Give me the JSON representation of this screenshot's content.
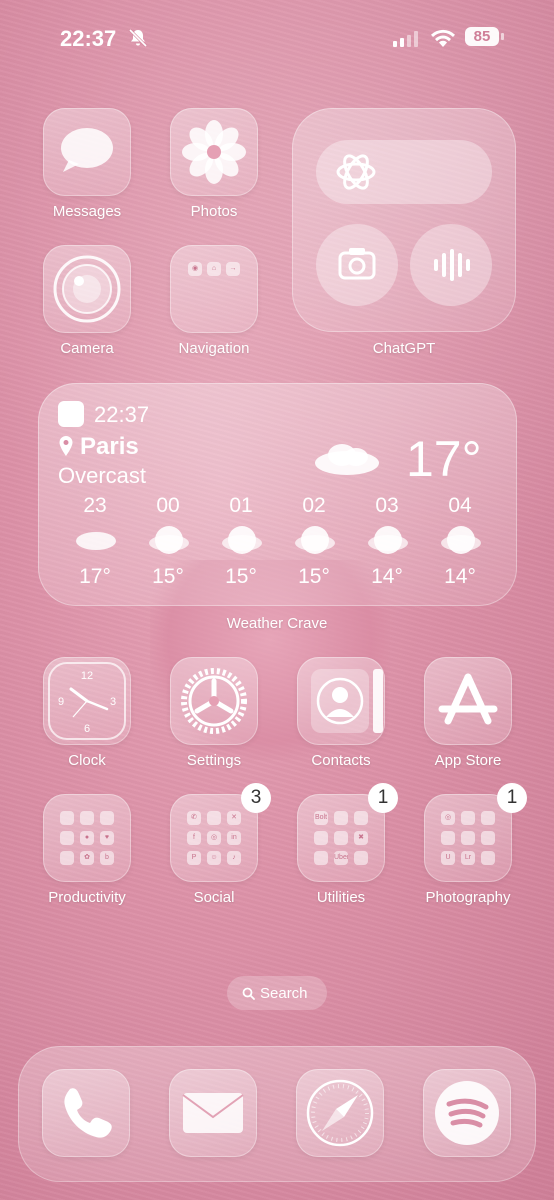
{
  "status": {
    "time": "22:37",
    "battery": "85"
  },
  "apps_row1": [
    {
      "label": "Messages",
      "icon": "messages-icon"
    },
    {
      "label": "Photos",
      "icon": "photos-icon"
    }
  ],
  "apps_row2": [
    {
      "label": "Camera",
      "icon": "camera-icon"
    },
    {
      "label": "Navigation",
      "icon": "folder-icon"
    }
  ],
  "chatgpt_widget": {
    "label": "ChatGPT"
  },
  "weather": {
    "time": "22:37",
    "city": "Paris",
    "condition": "Overcast",
    "temperature": "17°",
    "label": "Weather Crave",
    "hours": [
      {
        "hour": "23",
        "temp": "17°"
      },
      {
        "hour": "00",
        "temp": "15°"
      },
      {
        "hour": "01",
        "temp": "15°"
      },
      {
        "hour": "02",
        "temp": "15°"
      },
      {
        "hour": "03",
        "temp": "14°"
      },
      {
        "hour": "04",
        "temp": "14°"
      }
    ]
  },
  "apps_row3": [
    {
      "label": "Clock",
      "icon": "clock-icon"
    },
    {
      "label": "Settings",
      "icon": "gear-icon"
    },
    {
      "label": "Contacts",
      "icon": "contacts-icon"
    },
    {
      "label": "App Store",
      "icon": "app-store-icon"
    }
  ],
  "folders": [
    {
      "label": "Productivity",
      "badge": ""
    },
    {
      "label": "Social",
      "badge": "3"
    },
    {
      "label": "Utilities",
      "badge": "1"
    },
    {
      "label": "Photography",
      "badge": "1"
    }
  ],
  "utilities_minis": [
    "Bolt",
    "",
    "",
    "",
    "",
    "",
    "",
    "Uber",
    ""
  ],
  "photography_minis": [
    "",
    "",
    "",
    "",
    "",
    "",
    "",
    "Lr",
    ""
  ],
  "search": {
    "label": "Search"
  },
  "dock": [
    {
      "icon": "phone-icon"
    },
    {
      "icon": "mail-icon"
    },
    {
      "icon": "safari-icon"
    },
    {
      "icon": "spotify-icon"
    }
  ]
}
